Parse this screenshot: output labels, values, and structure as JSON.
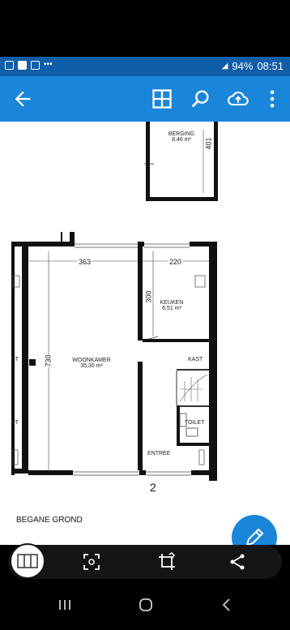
{
  "status": {
    "battery": "94%",
    "time": "08:51"
  },
  "plan": {
    "rooms": {
      "berging": {
        "name": "BERGING",
        "area": "8,46 m²"
      },
      "keuken": {
        "name": "KEUKEN",
        "area": "6,51 m²"
      },
      "woonkamer": {
        "name": "WOONKAMER",
        "area": "35,30 m²"
      },
      "kast_left": "ST",
      "kast_right": "KAST",
      "toilet_left": "ET",
      "toilet_right": "TOILET",
      "entree": "ENTREE"
    },
    "dimensions": {
      "d401": "401",
      "d363": "363",
      "d220": "220",
      "d300": "300",
      "d730": "730"
    },
    "page_number": "2",
    "floor_title": "BEGANE GROND"
  },
  "colors": {
    "app_bar": "#1a86d9",
    "status_bar": "#0f5ea8"
  },
  "icons": [
    "back-arrow-icon",
    "grid-icon",
    "search-icon",
    "cloud-upload-icon",
    "more-vert-icon",
    "scan-icon",
    "crop-icon",
    "share-icon",
    "pencil-icon"
  ]
}
